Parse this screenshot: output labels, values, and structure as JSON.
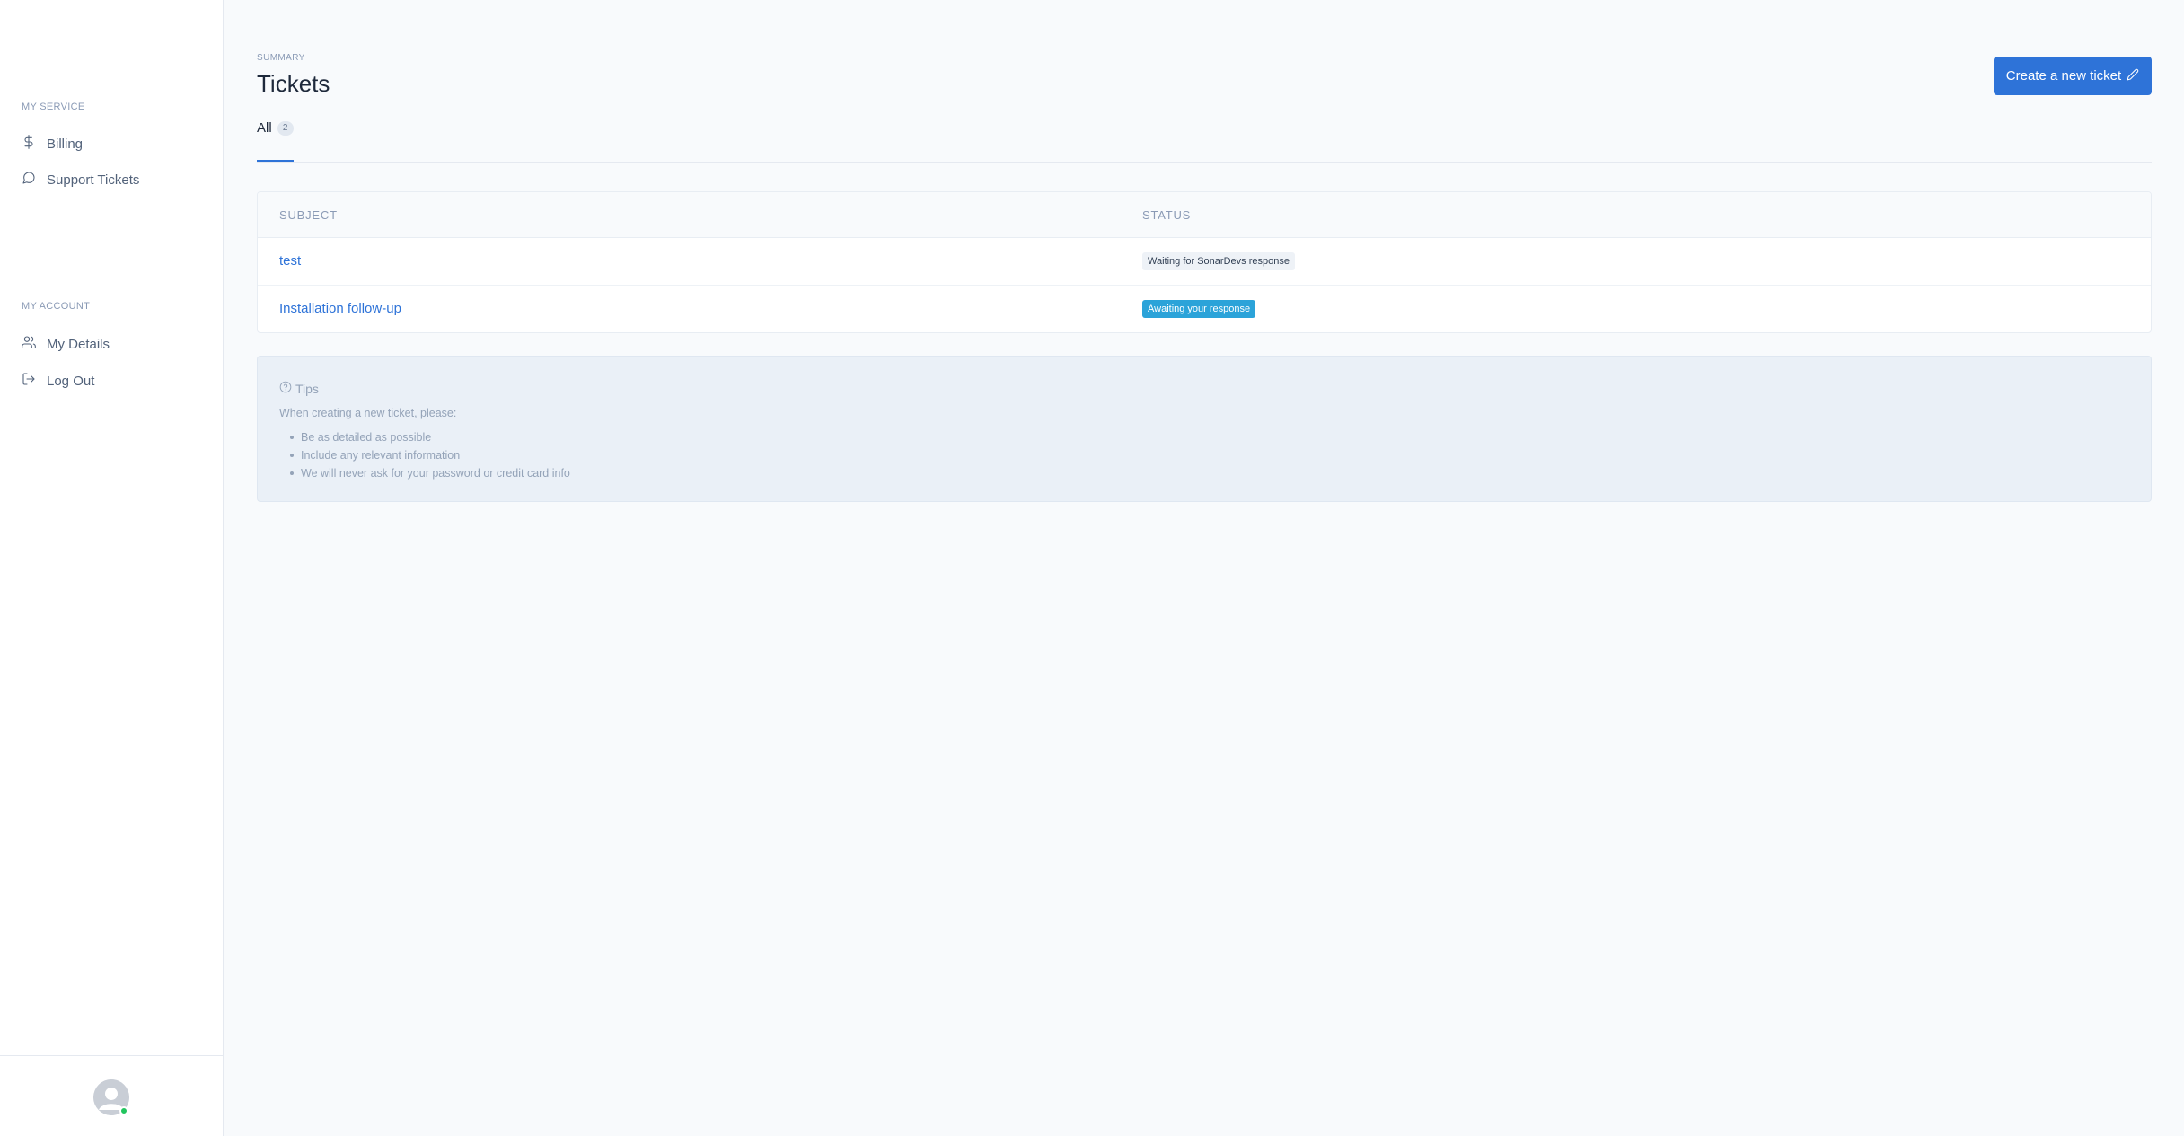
{
  "sidebar": {
    "sections": [
      {
        "title": "MY SERVICE",
        "items": [
          {
            "label": "Billing",
            "icon": "dollar-icon"
          },
          {
            "label": "Support Tickets",
            "icon": "chat-bubble-icon"
          }
        ]
      },
      {
        "title": "MY ACCOUNT",
        "items": [
          {
            "label": "My Details",
            "icon": "users-icon"
          },
          {
            "label": "Log Out",
            "icon": "logout-icon"
          }
        ]
      }
    ],
    "avatar_status_color": "#22c55e"
  },
  "header": {
    "eyebrow": "SUMMARY",
    "title": "Tickets",
    "create_button_label": "Create a new ticket",
    "create_button_icon": "pencil-icon"
  },
  "tabs": [
    {
      "label": "All",
      "count": "2",
      "active": true
    }
  ],
  "table": {
    "columns": [
      "SUBJECT",
      "STATUS"
    ],
    "rows": [
      {
        "subject": "test",
        "status": "Waiting for SonarDevs response",
        "status_style": "neutral"
      },
      {
        "subject": "Installation follow-up",
        "status": "Awaiting your response",
        "status_style": "info"
      }
    ]
  },
  "tips": {
    "title": "Tips",
    "icon": "question-circle-icon",
    "intro": "When creating a new ticket, please:",
    "items": [
      "Be as detailed as possible",
      "Include any relevant information",
      "We will never ask for your password or credit card info"
    ]
  },
  "colors": {
    "accent": "#2e73d8",
    "info_badge": "#2ba3d9",
    "page_bg": "#f8fafc"
  }
}
